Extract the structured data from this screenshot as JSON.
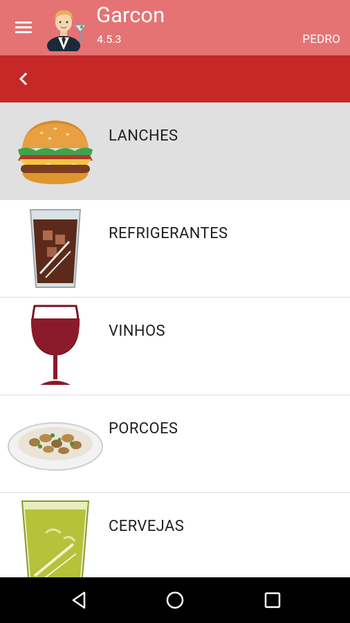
{
  "app": {
    "title": "Garcon",
    "version": "4.5.3",
    "user": "PEDRO",
    "colors": {
      "appbar": "#e57373",
      "subbar": "#c62828",
      "selected_row": "#e0e0e0"
    }
  },
  "toolbar": {
    "menu_icon": "hamburger-menu-icon",
    "back_icon": "chevron-left-icon"
  },
  "categories": [
    {
      "label": "LANCHES",
      "icon": "burger-icon",
      "selected": true
    },
    {
      "label": "REFRIGERANTES",
      "icon": "soda-glass-icon",
      "selected": false
    },
    {
      "label": "VINHOS",
      "icon": "wine-glass-icon",
      "selected": false
    },
    {
      "label": "PORCOES",
      "icon": "food-plate-icon",
      "selected": false
    },
    {
      "label": "CERVEJAS",
      "icon": "beer-glass-icon",
      "selected": false
    }
  ],
  "navigation": {
    "back_icon": "nav-back-icon",
    "home_icon": "nav-home-icon",
    "recents_icon": "nav-recents-icon"
  }
}
